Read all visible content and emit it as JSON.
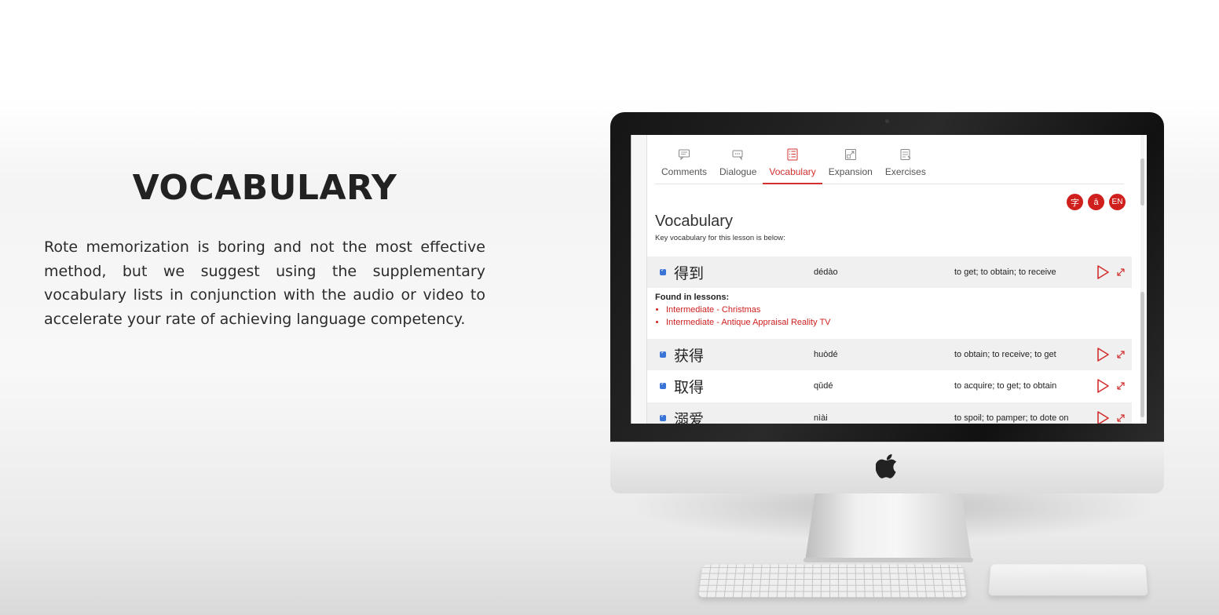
{
  "hero": {
    "title": "VOCABULARY",
    "description": "Rote memorization is boring and not the most effective method, but we suggest using the supplementary vocabulary lists in conjunction with the audio or video to accelerate your rate of achieving language competency."
  },
  "app": {
    "tabs": [
      {
        "label": "Comments",
        "icon": "comment-icon",
        "active": false
      },
      {
        "label": "Dialogue",
        "icon": "dialogue-icon",
        "active": false
      },
      {
        "label": "Vocabulary",
        "icon": "list-icon",
        "active": true
      },
      {
        "label": "Expansion",
        "icon": "expand-icon",
        "active": false
      },
      {
        "label": "Exercises",
        "icon": "exercise-icon",
        "active": false
      }
    ],
    "lang_buttons": [
      "字",
      "ā",
      "EN"
    ],
    "section_title": "Vocabulary",
    "section_subtitle": "Key vocabulary for this lesson is below:",
    "vocab": [
      {
        "hanzi": "得到",
        "pinyin": "dédào",
        "english": "to get; to obtain; to receive"
      },
      {
        "hanzi": "获得",
        "pinyin": "huòdé",
        "english": "to obtain; to receive; to get"
      },
      {
        "hanzi": "取得",
        "pinyin": "qǔdé",
        "english": "to acquire; to get; to obtain"
      },
      {
        "hanzi": "溺爱",
        "pinyin": "nìài",
        "english": "to spoil; to pamper; to dote on"
      }
    ],
    "found_in": {
      "title": "Found in lessons:",
      "lessons": [
        "Intermediate - Christmas",
        "Intermediate - Antique Appraisal Reality TV"
      ]
    },
    "colors": {
      "accent": "#d32f2f",
      "checkbox": "#3a74d6"
    }
  }
}
